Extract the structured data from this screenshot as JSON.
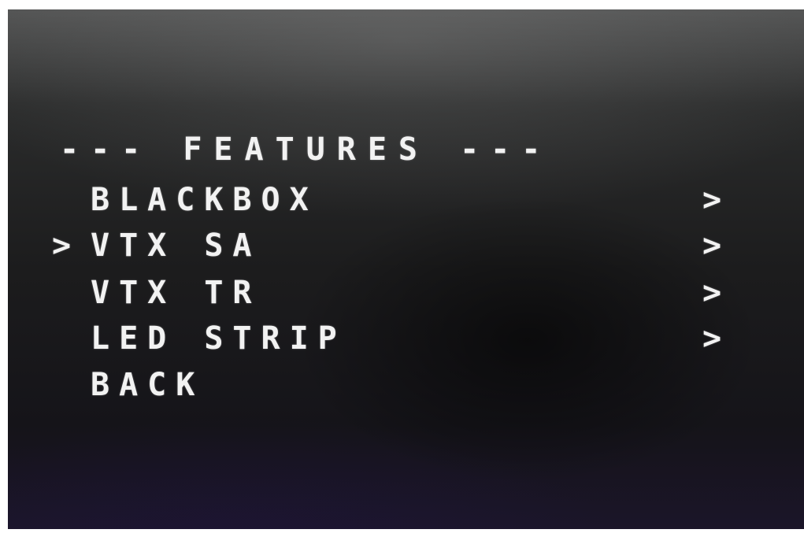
{
  "osd": {
    "title": "--- FEATURES ---",
    "cursor": ">",
    "items": [
      {
        "label": "BLACKBOX",
        "arrow": ">"
      },
      {
        "label": "VTX SA",
        "arrow": ">"
      },
      {
        "label": "VTX TR",
        "arrow": ">"
      },
      {
        "label": "LED STRIP",
        "arrow": ">"
      },
      {
        "label": "BACK",
        "arrow": ""
      }
    ],
    "selected_index": 1
  }
}
